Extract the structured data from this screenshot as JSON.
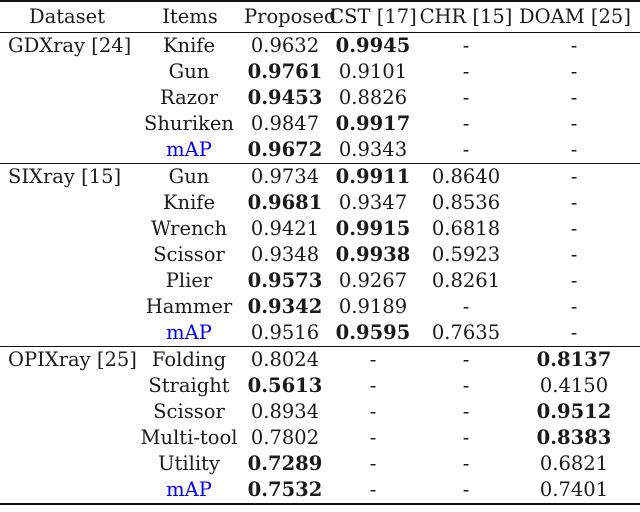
{
  "table": {
    "headers": [
      "Dataset",
      "Items",
      "Proposed",
      "CST [17]",
      "CHR [15]",
      "DOAM [25]"
    ],
    "dash": "-",
    "map_label": "mAP",
    "map_color": "#0000ff",
    "groups": [
      {
        "dataset": "GDXray [24]",
        "rows": [
          {
            "item": "Knife",
            "item_is_map": false,
            "proposed": "0.9632",
            "proposed_bold": false,
            "cst": "0.9945",
            "cst_bold": true,
            "chr": "-",
            "chr_bold": false,
            "doam": "-",
            "doam_bold": false
          },
          {
            "item": "Gun",
            "item_is_map": false,
            "proposed": "0.9761",
            "proposed_bold": true,
            "cst": "0.9101",
            "cst_bold": false,
            "chr": "-",
            "chr_bold": false,
            "doam": "-",
            "doam_bold": false
          },
          {
            "item": "Razor",
            "item_is_map": false,
            "proposed": "0.9453",
            "proposed_bold": true,
            "cst": "0.8826",
            "cst_bold": false,
            "chr": "-",
            "chr_bold": false,
            "doam": "-",
            "doam_bold": false
          },
          {
            "item": "Shuriken",
            "item_is_map": false,
            "proposed": "0.9847",
            "proposed_bold": false,
            "cst": "0.9917",
            "cst_bold": true,
            "chr": "-",
            "chr_bold": false,
            "doam": "-",
            "doam_bold": false
          },
          {
            "item": "mAP",
            "item_is_map": true,
            "proposed": "0.9672",
            "proposed_bold": true,
            "cst": "0.9343",
            "cst_bold": false,
            "chr": "-",
            "chr_bold": false,
            "doam": "-",
            "doam_bold": false
          }
        ]
      },
      {
        "dataset": "SIXray [15]",
        "rows": [
          {
            "item": "Gun",
            "item_is_map": false,
            "proposed": "0.9734",
            "proposed_bold": false,
            "cst": "0.9911",
            "cst_bold": true,
            "chr": "0.8640",
            "chr_bold": false,
            "doam": "-",
            "doam_bold": false
          },
          {
            "item": "Knife",
            "item_is_map": false,
            "proposed": "0.9681",
            "proposed_bold": true,
            "cst": "0.9347",
            "cst_bold": false,
            "chr": "0.8536",
            "chr_bold": false,
            "doam": "-",
            "doam_bold": false
          },
          {
            "item": "Wrench",
            "item_is_map": false,
            "proposed": "0.9421",
            "proposed_bold": false,
            "cst": "0.9915",
            "cst_bold": true,
            "chr": "0.6818",
            "chr_bold": false,
            "doam": "-",
            "doam_bold": false
          },
          {
            "item": "Scissor",
            "item_is_map": false,
            "proposed": "0.9348",
            "proposed_bold": false,
            "cst": "0.9938",
            "cst_bold": true,
            "chr": "0.5923",
            "chr_bold": false,
            "doam": "-",
            "doam_bold": false
          },
          {
            "item": "Plier",
            "item_is_map": false,
            "proposed": "0.9573",
            "proposed_bold": true,
            "cst": "0.9267",
            "cst_bold": false,
            "chr": "0.8261",
            "chr_bold": false,
            "doam": "-",
            "doam_bold": false
          },
          {
            "item": "Hammer",
            "item_is_map": false,
            "proposed": "0.9342",
            "proposed_bold": true,
            "cst": "0.9189",
            "cst_bold": false,
            "chr": "-",
            "chr_bold": false,
            "doam": "-",
            "doam_bold": false
          },
          {
            "item": "mAP",
            "item_is_map": true,
            "proposed": "0.9516",
            "proposed_bold": false,
            "cst": "0.9595",
            "cst_bold": true,
            "chr": "0.7635",
            "chr_bold": false,
            "doam": "-",
            "doam_bold": false
          }
        ]
      },
      {
        "dataset": "OPIXray [25]",
        "rows": [
          {
            "item": "Folding",
            "item_is_map": false,
            "proposed": "0.8024",
            "proposed_bold": false,
            "cst": "-",
            "cst_bold": false,
            "chr": "-",
            "chr_bold": false,
            "doam": "0.8137",
            "doam_bold": true
          },
          {
            "item": "Straight",
            "item_is_map": false,
            "proposed": "0.5613",
            "proposed_bold": true,
            "cst": "-",
            "cst_bold": false,
            "chr": "-",
            "chr_bold": false,
            "doam": "0.4150",
            "doam_bold": false
          },
          {
            "item": "Scissor",
            "item_is_map": false,
            "proposed": "0.8934",
            "proposed_bold": false,
            "cst": "-",
            "cst_bold": false,
            "chr": "-",
            "chr_bold": false,
            "doam": "0.9512",
            "doam_bold": true
          },
          {
            "item": "Multi-tool",
            "item_is_map": false,
            "proposed": "0.7802",
            "proposed_bold": false,
            "cst": "-",
            "cst_bold": false,
            "chr": "-",
            "chr_bold": false,
            "doam": "0.8383",
            "doam_bold": true
          },
          {
            "item": "Utility",
            "item_is_map": false,
            "proposed": "0.7289",
            "proposed_bold": true,
            "cst": "-",
            "cst_bold": false,
            "chr": "-",
            "chr_bold": false,
            "doam": "0.6821",
            "doam_bold": false
          },
          {
            "item": "mAP",
            "item_is_map": true,
            "proposed": "0.7532",
            "proposed_bold": true,
            "cst": "-",
            "cst_bold": false,
            "chr": "-",
            "chr_bold": false,
            "doam": "0.7401",
            "doam_bold": false
          }
        ]
      }
    ]
  }
}
